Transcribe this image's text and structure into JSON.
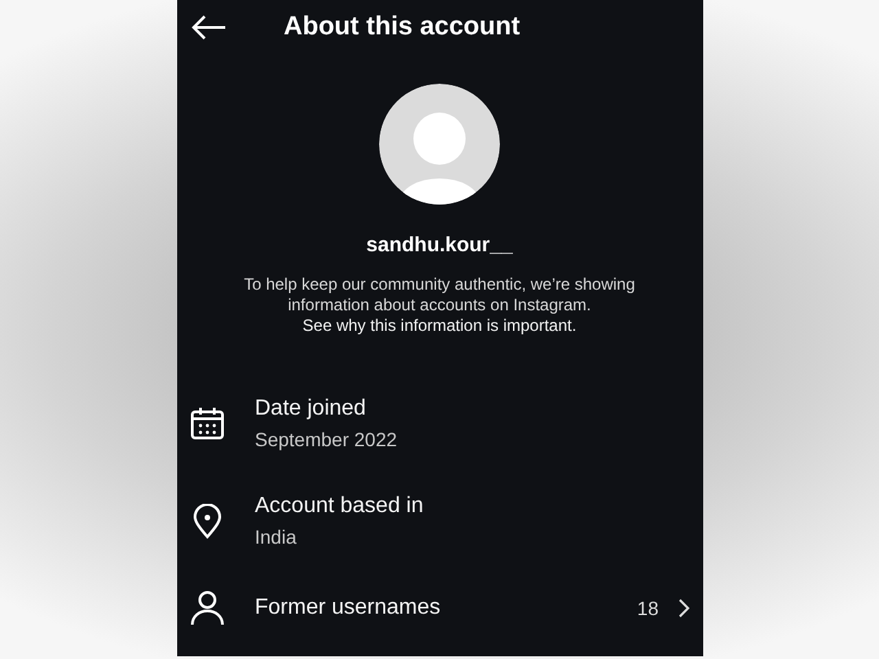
{
  "header": {
    "title": "About this account"
  },
  "profile": {
    "username": "sandhu.kour__",
    "description": "To help keep our community authentic, we’re showing information about accounts on Instagram.",
    "link": "See why this information is important."
  },
  "rows": [
    {
      "kind": "detail",
      "label": "Date joined",
      "value": "September 2022"
    },
    {
      "kind": "detail",
      "label": "Account based in",
      "value": "India"
    },
    {
      "kind": "link",
      "label": "Former usernames",
      "count": "18"
    }
  ]
}
